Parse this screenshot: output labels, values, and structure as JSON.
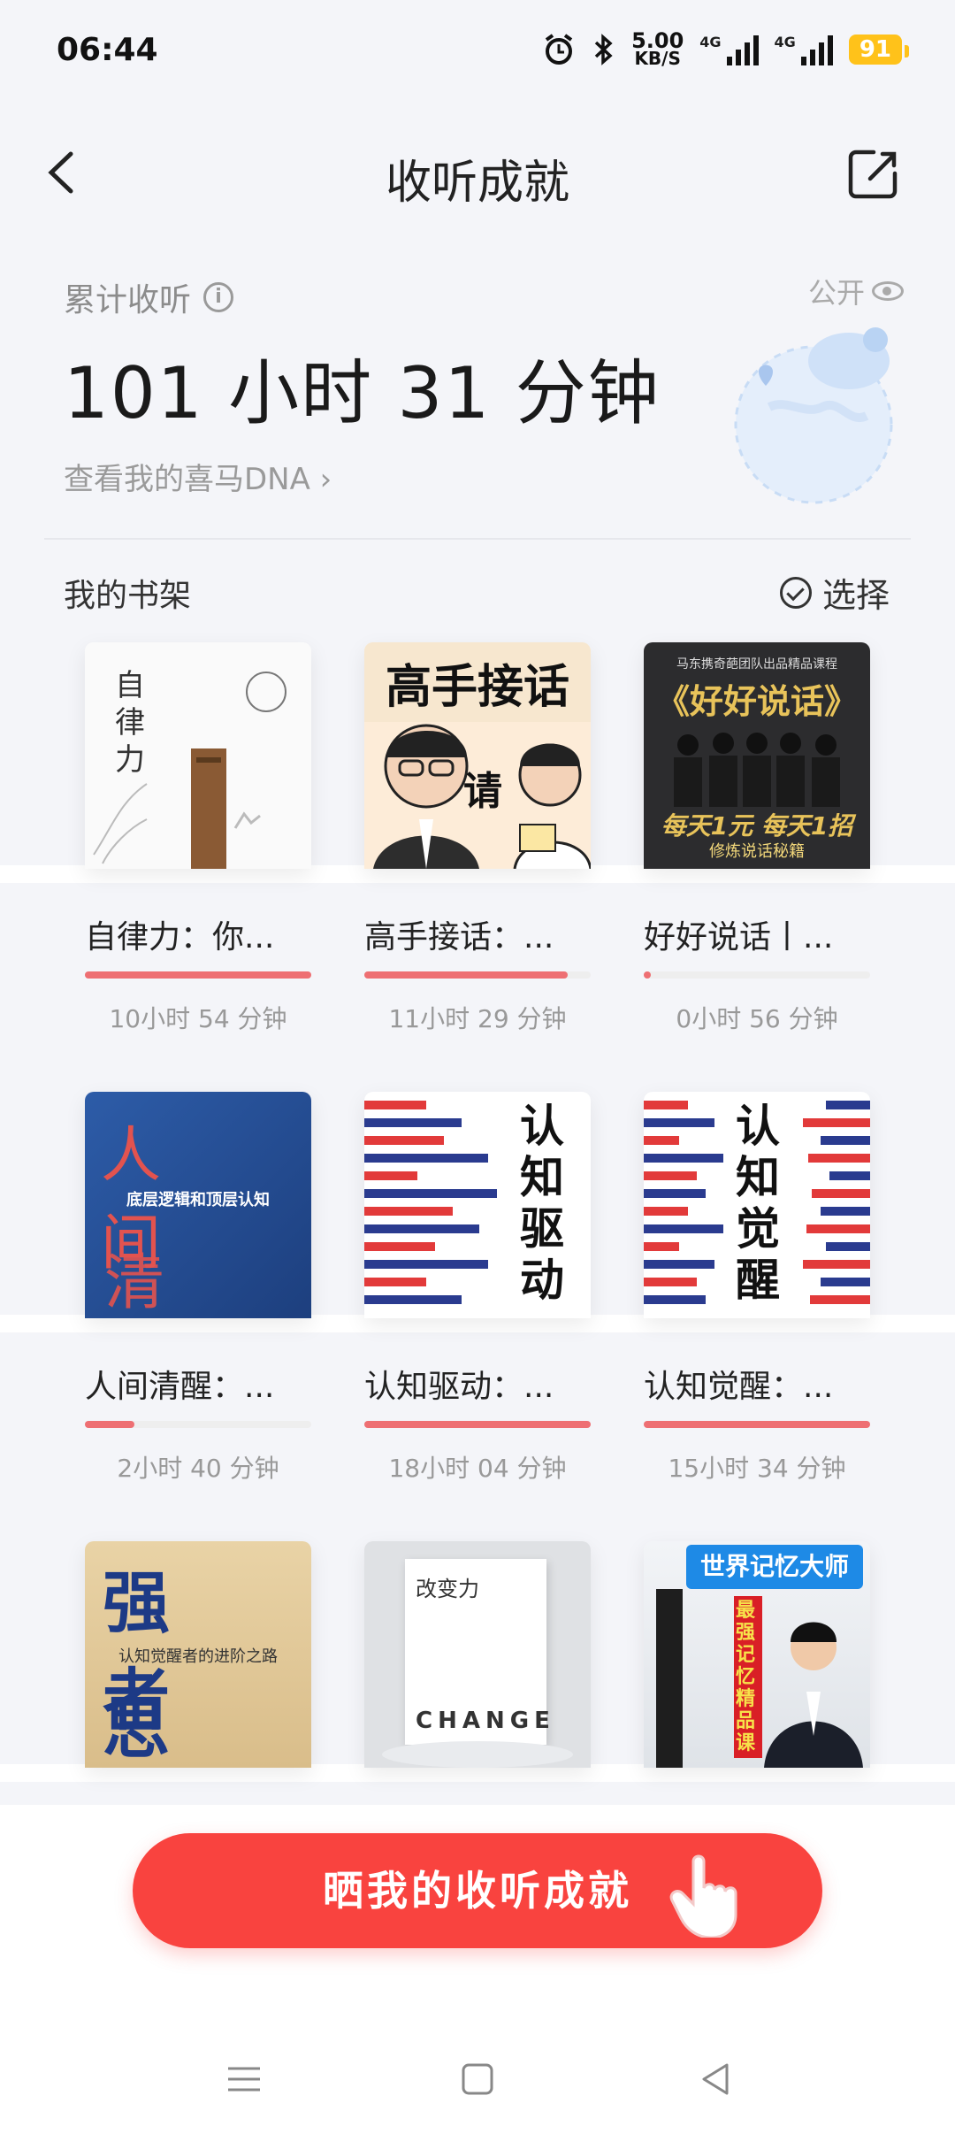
{
  "status_bar": {
    "time": "06:44",
    "net_speed_value": "5.00",
    "net_speed_unit": "KB/S",
    "sig1_label": "4G",
    "sig2_label": "4G",
    "battery": "91"
  },
  "header": {
    "title": "收听成就"
  },
  "summary": {
    "label": "累计收听",
    "total": "101 小时 31 分钟",
    "dna_link": "查看我的喜马DNA",
    "public_label": "公开"
  },
  "shelf": {
    "title": "我的书架",
    "select_label": "选择",
    "books": [
      {
        "name": "自律力：你...",
        "duration": "10小时 54 分钟",
        "progress": 1.0,
        "cover_title": "自律力"
      },
      {
        "name": "高手接话：...",
        "duration": "11小时 29 分钟",
        "progress": 0.9,
        "cover_title": "高手接话",
        "cover_word": "请"
      },
      {
        "name": "好好说话丨...",
        "duration": "0小时 56 分钟",
        "progress": 0.03,
        "cover_title": "《好好说话》",
        "cover_top": "马东携奇葩团队出品精品课程",
        "cover_bottom": "每天1元 每天1招",
        "cover_sub": "修炼说话秘籍"
      },
      {
        "name": "人间清醒：...",
        "duration": "2小时 40 分钟",
        "progress": 0.22,
        "cover_title_top": "人 间",
        "cover_mid": "底层逻辑和顶层认知",
        "cover_title_bot": "清 醒"
      },
      {
        "name": "认知驱动：...",
        "duration": "18小时 04 分钟",
        "progress": 1.0,
        "cover_title": "认知驱动"
      },
      {
        "name": "认知觉醒：...",
        "duration": "15小时 34 分钟",
        "progress": 1.0,
        "cover_title": "认知觉醒"
      },
      {
        "cover_title_top": "强 者",
        "cover_mid": "认知觉醒者的进阶之路",
        "cover_title_bot": "思 维"
      },
      {
        "cover_title": "改变力",
        "cover_word": "CHANGE"
      },
      {
        "cover_title": "世界记忆大师",
        "cover_sub": "最强记忆精品课"
      }
    ]
  },
  "cta": {
    "label": "晒我的收听成就"
  },
  "colors": {
    "accent": "#f9433f",
    "progress": "#ee6f73"
  }
}
